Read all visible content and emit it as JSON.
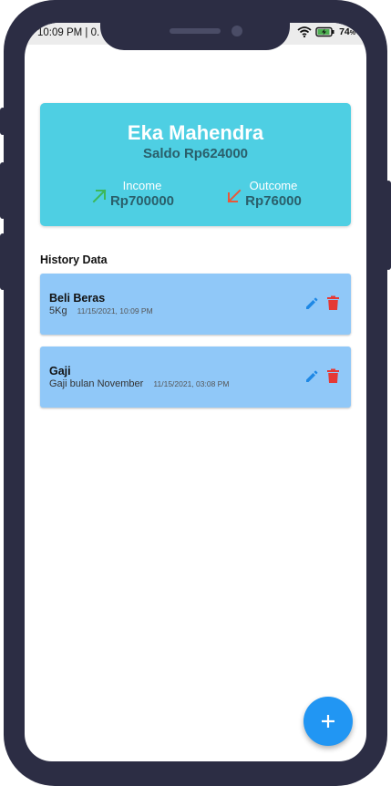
{
  "status_bar": {
    "time": "10:09 PM | 0.",
    "battery": "74",
    "battery_unit": "%"
  },
  "balance_card": {
    "name": "Eka Mahendra",
    "saldo": "Saldo Rp624000",
    "income": {
      "label": "Income",
      "value": "Rp700000",
      "icon": "arrow-up-right-icon",
      "color": "#3cb85a"
    },
    "outcome": {
      "label": "Outcome",
      "value": "Rp76000",
      "icon": "arrow-down-left-icon",
      "color": "#e8583a"
    }
  },
  "history": {
    "title": "History Data",
    "items": [
      {
        "title": "Beli Beras",
        "description": "5Kg",
        "date": "11/15/2021, 10:09 PM"
      },
      {
        "title": "Gaji",
        "description": "Gaji bulan November",
        "date": "11/15/2021, 03:08 PM"
      }
    ]
  },
  "icons": {
    "edit": "pencil-icon",
    "delete": "trash-icon",
    "fab": "plus-icon"
  },
  "colors": {
    "card": "#4ecfe3",
    "item": "#90c8f8",
    "fab": "#2196f3",
    "edit": "#1e88e5",
    "delete": "#e53935",
    "phone_frame": "#2c2d44"
  }
}
